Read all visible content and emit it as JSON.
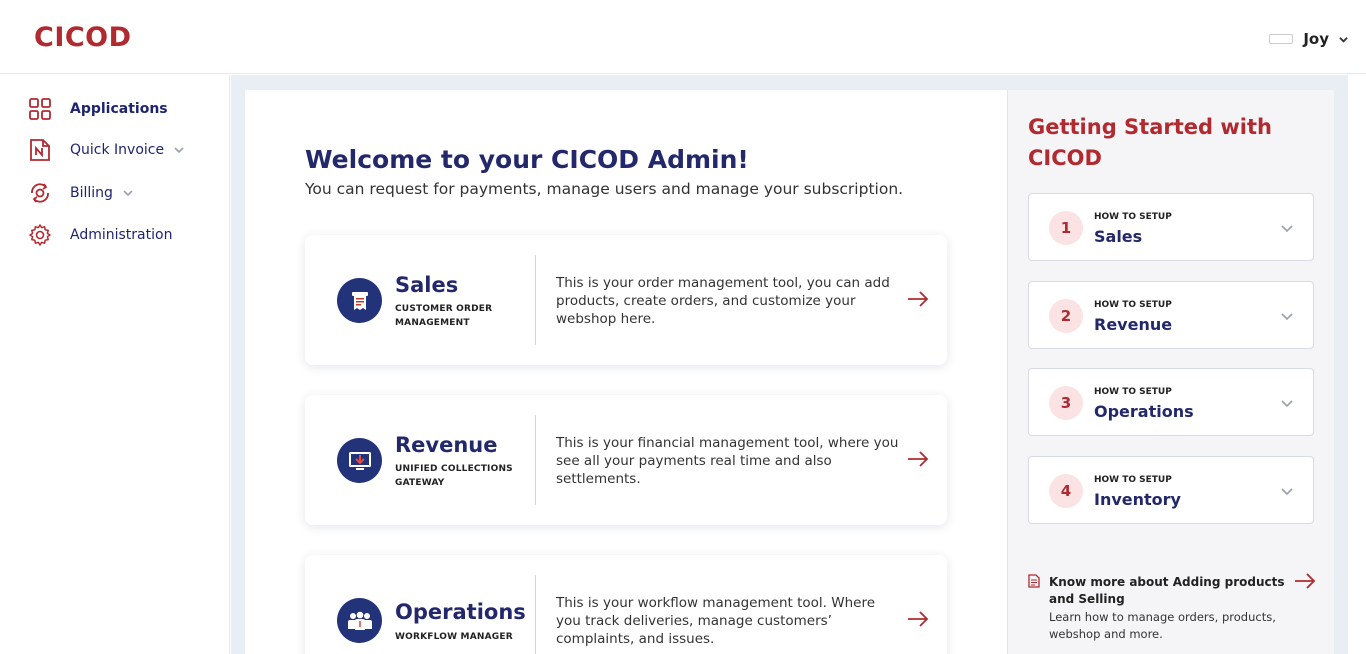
{
  "header": {
    "logo": "CICOD",
    "user_name": "Joy"
  },
  "sidebar": {
    "items": [
      {
        "label": "Applications",
        "icon": "grid-icon"
      },
      {
        "label": "Quick Invoice",
        "icon": "invoice-icon"
      },
      {
        "label": "Billing",
        "icon": "billing-icon"
      },
      {
        "label": "Administration",
        "icon": "gear-icon"
      }
    ]
  },
  "main": {
    "title": "Welcome to your CICOD Admin!",
    "subtitle": "You can request for payments, manage users and manage your subscription.",
    "cards": [
      {
        "title": "Sales",
        "subtitle": "CUSTOMER ORDER MANAGEMENT",
        "description": "This is your order management tool, you can add products, create orders, and customize your webshop here.",
        "icon": "receipt-icon"
      },
      {
        "title": "Revenue",
        "subtitle": "UNIFIED COLLECTIONS GATEWAY",
        "description": "This is your financial management tool, where you see all your payments real time and also settlements.",
        "icon": "monitor-download-icon"
      },
      {
        "title": "Operations",
        "subtitle": "WORKFLOW MANAGER",
        "description": "This is your workflow management tool. Where you track deliveries, manage customers’ complaints, and issues.",
        "icon": "team-icon"
      }
    ]
  },
  "getting_started": {
    "title": "Getting Started with CICOD",
    "steps": [
      {
        "number": "1",
        "prefix": "HOW TO SETUP",
        "title": "Sales"
      },
      {
        "number": "2",
        "prefix": "HOW TO SETUP",
        "title": "Revenue"
      },
      {
        "number": "3",
        "prefix": "HOW TO SETUP",
        "title": "Operations"
      },
      {
        "number": "4",
        "prefix": "HOW TO SETUP",
        "title": "Inventory"
      }
    ],
    "know_more": {
      "title": "Know more about Adding products and Selling",
      "description": "Learn how to manage orders, products, webshop and more."
    }
  },
  "colors": {
    "brand_red": "#b02a30",
    "navy": "#23286b",
    "icon_navy": "#23337a"
  }
}
